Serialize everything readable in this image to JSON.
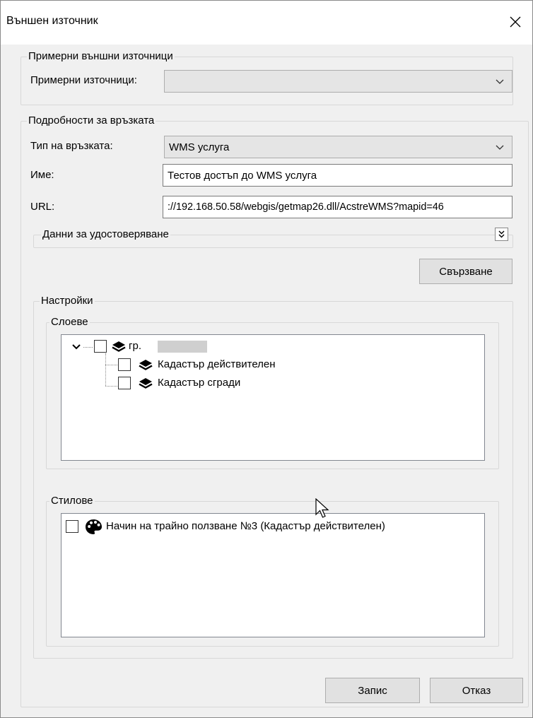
{
  "window": {
    "title": "Външен източник"
  },
  "examples_group": {
    "legend": "Примерни външни източници",
    "sources_label": "Примерни източници:",
    "sources_value": ""
  },
  "connection_group": {
    "legend": "Подробности за връзката",
    "type_label": "Тип на връзката:",
    "type_value": "WMS услуга",
    "name_label": "Име:",
    "name_value": "Тестов достъп до WMS услуга",
    "url_label": "URL:",
    "url_value": "://192.168.50.58/webgis/getmap26.dll/AcstreWMS?mapid=46",
    "auth_label": "Данни за удостоверяване",
    "connect_button": "Свързване"
  },
  "settings_group": {
    "legend": "Настройки",
    "layers": {
      "legend": "Слоеве",
      "root": {
        "label": "гр.",
        "checked": false,
        "icon": "layers-icon"
      },
      "children": [
        {
          "label": "Кадастър действителен",
          "checked": false,
          "icon": "layers-icon"
        },
        {
          "label": "Кадастър сгради",
          "checked": false,
          "icon": "layers-icon"
        }
      ]
    },
    "styles": {
      "legend": "Стилове",
      "items": [
        {
          "label": "Начин на трайно ползване №3 (Кадастър действителен)",
          "checked": false,
          "icon": "palette-icon"
        }
      ]
    }
  },
  "footer": {
    "save_button": "Запис",
    "cancel_button": "Отказ"
  }
}
